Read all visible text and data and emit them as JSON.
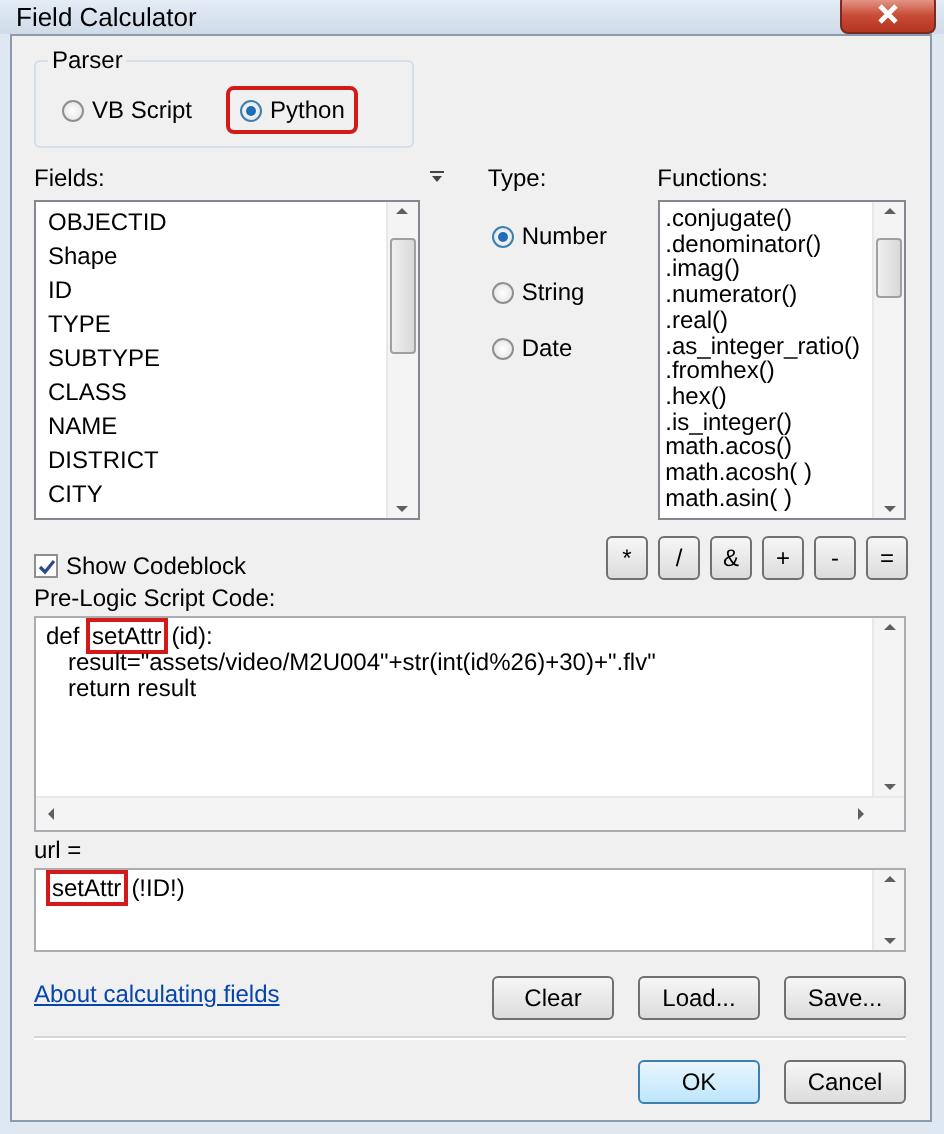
{
  "window": {
    "title": "Field Calculator"
  },
  "parser": {
    "label": "Parser",
    "options": [
      {
        "label": "VB Script",
        "selected": false,
        "annotated": false
      },
      {
        "label": "Python",
        "selected": true,
        "annotated": true
      }
    ]
  },
  "fields": {
    "label": "Fields:",
    "items": [
      "OBJECTID",
      "Shape",
      "ID",
      "TYPE",
      "SUBTYPE",
      "CLASS",
      "NAME",
      "DISTRICT",
      "CITY"
    ]
  },
  "type": {
    "label": "Type:",
    "options": [
      {
        "label": "Number",
        "selected": true
      },
      {
        "label": "String",
        "selected": false
      },
      {
        "label": "Date",
        "selected": false
      }
    ]
  },
  "functions": {
    "label": "Functions:",
    "items": [
      ".conjugate()",
      ".denominator()",
      ".imag()",
      ".numerator()",
      ".real()",
      ".as_integer_ratio()",
      ".fromhex()",
      ".hex()",
      ".is_integer()",
      "math.acos()",
      "math.acosh( )",
      "math.asin( )"
    ]
  },
  "show_codeblock": {
    "label": "Show Codeblock",
    "checked": true
  },
  "operators": [
    "*",
    "/",
    "&",
    "+",
    "-",
    "="
  ],
  "pre_logic": {
    "label": "Pre-Logic Script Code:",
    "lines": [
      {
        "indented": false,
        "parts": [
          {
            "text": "def ",
            "annotated": false
          },
          {
            "text": "setAttr",
            "annotated": true
          },
          {
            "text": "(id):",
            "annotated": false
          }
        ]
      },
      {
        "indented": true,
        "parts": [
          {
            "text": "result=\"assets/video/M2U004\"+str(int(id%26)+30)+\".flv\"",
            "annotated": false
          }
        ]
      },
      {
        "indented": true,
        "parts": [
          {
            "text": "return result",
            "annotated": false
          }
        ]
      }
    ]
  },
  "expression": {
    "label": "url =",
    "lines": [
      {
        "indented": false,
        "parts": [
          {
            "text": "setAttr",
            "annotated": true
          },
          {
            "text": "(!ID!)",
            "annotated": false
          }
        ]
      }
    ]
  },
  "help_link": "About calculating fields",
  "buttons": [
    "Clear",
    "Load...",
    "Save..."
  ],
  "dialog_buttons": [
    {
      "label": "OK",
      "default": true
    },
    {
      "label": "Cancel",
      "default": false
    }
  ]
}
